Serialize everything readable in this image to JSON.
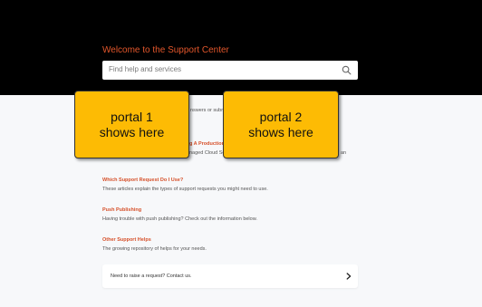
{
  "hero": {
    "title": "Welcome to the Support Center",
    "search_placeholder": "Find help and services",
    "search_icon": "search-icon"
  },
  "partials": {
    "frag_1": "nswers or subm",
    "frag_2": "g A Production",
    "frag_3": "naged Cloud Se",
    "frag_4": "an"
  },
  "categories": [
    {
      "title": "Which Support Request Do I Use?",
      "description": "These articles explain the types of support requests you might need to use."
    },
    {
      "title": "Push Publishing",
      "description": "Having trouble with push publishing? Check out the information below."
    },
    {
      "title": "Other Support Helps",
      "description": "The growing repository of helps for your needs."
    }
  ],
  "contact": {
    "label": "Need to raise a request? Contact us.",
    "chevron_icon": "chevron-right-icon"
  },
  "portals": {
    "portal_1": [
      "portal 1",
      "shows here"
    ],
    "portal_2": [
      "portal 2",
      "shows here"
    ]
  },
  "colors": {
    "hero_bg": "#000000",
    "accent": "#e2562b",
    "portal_yellow": "#fdbb04",
    "page_bg": "#f7f8fa"
  }
}
